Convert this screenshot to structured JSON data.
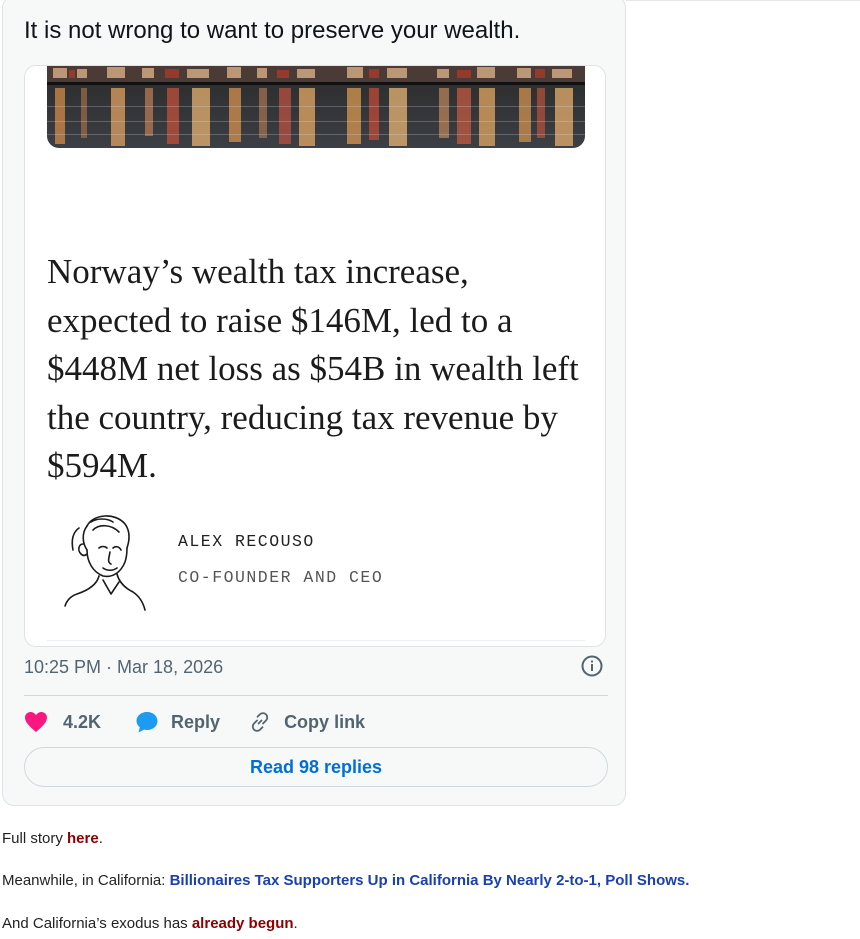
{
  "tweet": {
    "text": "It is not wrong to want to preserve your wealth.",
    "card": {
      "headline": "Norway’s wealth tax increase, expected to raise $146M, led to a $448M net loss as $54B in wealth left the country, reducing tax revenue by $594M.",
      "author_name": "ALEX RECOUSO",
      "author_title": "CO-FOUNDER AND CEO"
    },
    "timestamp": "10:25 PM · Mar 18, 2026",
    "like_count": "4.2K",
    "reply_label": "Reply",
    "copy_link_label": "Copy link",
    "read_replies_label": "Read 98 replies",
    "colors": {
      "like": "#f91880",
      "reply": "#1d9bf0",
      "link": "#006fd6"
    }
  },
  "article": {
    "p1_prefix": "Full story ",
    "p1_link": "here",
    "p1_suffix": ".",
    "p2_prefix": "Meanwhile, in California: ",
    "p2_link": "Billionaires Tax Supporters Up in California By Nearly 2-to-1, Poll Shows.",
    "p3_prefix": "And California’s exodus has ",
    "p3_link": "already begun",
    "p3_suffix": "."
  }
}
